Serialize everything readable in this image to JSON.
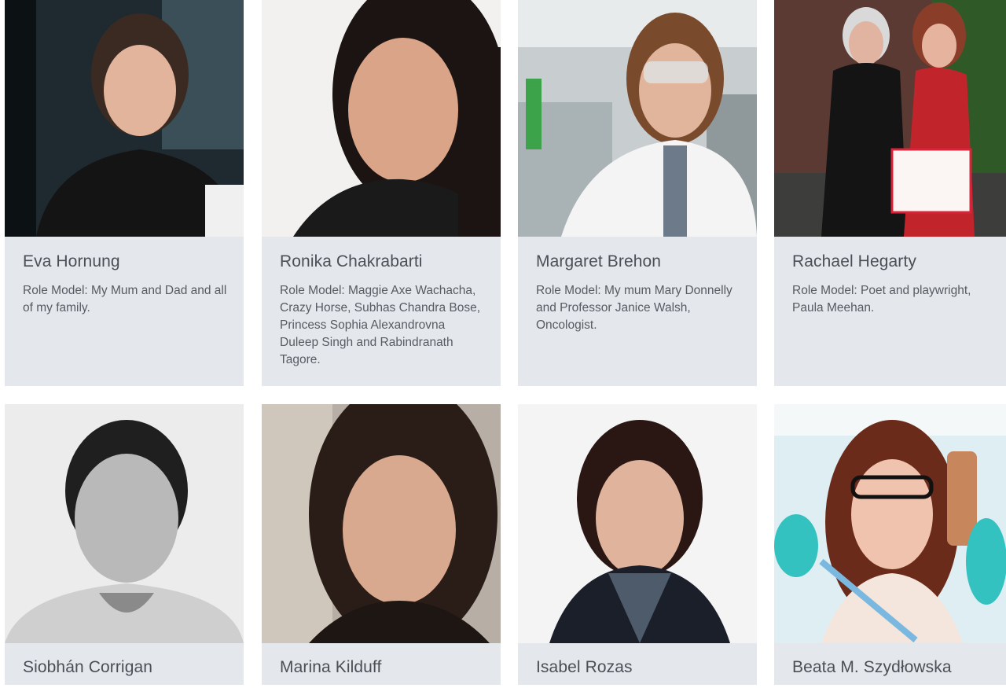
{
  "profiles": [
    {
      "name": "Eva Hornung",
      "role": "Role Model: My Mum and Dad and all of my family.",
      "photo": "portrait-photo"
    },
    {
      "name": "Ronika Chakrabarti",
      "role": "Role Model: Maggie Axe Wachacha, Crazy Horse, Subhas Chandra Bose, Princess Sophia Alexandrovna Duleep Singh and Rabindranath Tagore.",
      "photo": "portrait-photo"
    },
    {
      "name": "Margaret Brehon",
      "role": "Role Model: My mum Mary Donnelly and Professor Janice Walsh, Oncologist.",
      "photo": "portrait-photo"
    },
    {
      "name": "Rachael Hegarty",
      "role": "Role Model: Poet and playwright, Paula Meehan.",
      "photo": "portrait-photo"
    },
    {
      "name": "Siobhán Corrigan",
      "role": "",
      "photo": "portrait-photo"
    },
    {
      "name": "Marina Kilduff",
      "role": "",
      "photo": "portrait-photo"
    },
    {
      "name": "Isabel Rozas",
      "role": "",
      "photo": "portrait-photo"
    },
    {
      "name": "Beata M. Szydłowska",
      "role": "",
      "photo": "portrait-photo"
    }
  ],
  "colors": {
    "card_bg": "#e4e7ec",
    "name_text": "#4b4f56",
    "role_text": "#575b62"
  }
}
